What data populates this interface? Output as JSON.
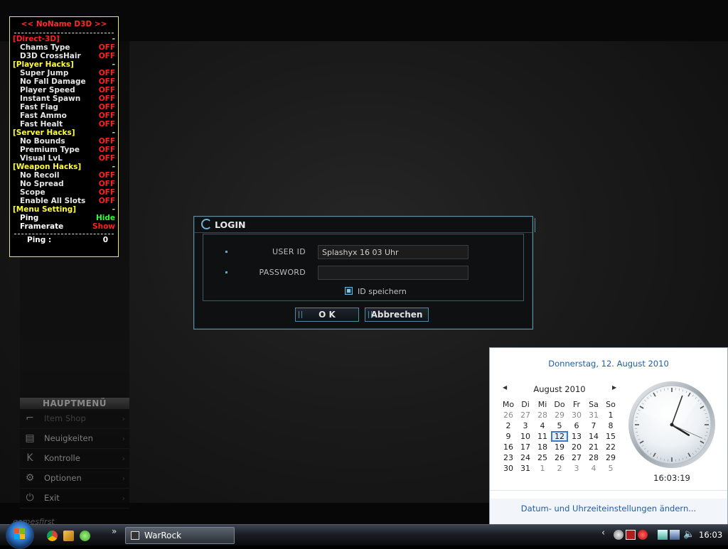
{
  "hack_menu": {
    "title": "<< NoName D3D >>",
    "rows": [
      {
        "label": "[Direct-3D]",
        "kind": "cat red",
        "value": "-",
        "vclass": "dash"
      },
      {
        "label": "Chams Type",
        "kind": "item",
        "value": "OFF",
        "vclass": "off"
      },
      {
        "label": "D3D CrossHair",
        "kind": "item",
        "value": "OFF",
        "vclass": "off"
      },
      {
        "label": "[Player Hacks]",
        "kind": "cat",
        "value": "-",
        "vclass": "dash"
      },
      {
        "label": "Super Jump",
        "kind": "item",
        "value": "OFF",
        "vclass": "off"
      },
      {
        "label": "No Fall Damage",
        "kind": "item",
        "value": "OFF",
        "vclass": "off"
      },
      {
        "label": "Player Speed",
        "kind": "item",
        "value": "OFF",
        "vclass": "off"
      },
      {
        "label": "Instant Spawn",
        "kind": "item",
        "value": "OFF",
        "vclass": "off"
      },
      {
        "label": "Fast Flag",
        "kind": "item",
        "value": "OFF",
        "vclass": "off"
      },
      {
        "label": "Fast Ammo",
        "kind": "item",
        "value": "OFF",
        "vclass": "off"
      },
      {
        "label": "Fast Healt",
        "kind": "item",
        "value": "OFF",
        "vclass": "off"
      },
      {
        "label": "[Server  Hacks]",
        "kind": "cat",
        "value": "-",
        "vclass": "dash"
      },
      {
        "label": "No Bounds",
        "kind": "item",
        "value": "OFF",
        "vclass": "off"
      },
      {
        "label": "Premium Type",
        "kind": "item",
        "value": "OFF",
        "vclass": "off"
      },
      {
        "label": "Visual LvL",
        "kind": "item",
        "value": "OFF",
        "vclass": "off"
      },
      {
        "label": "[Weapon  Hacks]",
        "kind": "cat",
        "value": "-",
        "vclass": "dash"
      },
      {
        "label": "No Recoil",
        "kind": "item",
        "value": "OFF",
        "vclass": "off"
      },
      {
        "label": "No Spread",
        "kind": "item",
        "value": "OFF",
        "vclass": "off"
      },
      {
        "label": "Scope",
        "kind": "item",
        "value": "OFF",
        "vclass": "off"
      },
      {
        "label": "Enable All Slots",
        "kind": "item",
        "value": "OFF",
        "vclass": "off"
      },
      {
        "label": "[Menu Setting]",
        "kind": "cat",
        "value": "-",
        "vclass": "dash"
      },
      {
        "label": "Ping",
        "kind": "item white",
        "value": "Hide",
        "vclass": "hide"
      },
      {
        "label": "Framerate",
        "kind": "item white",
        "value": "Show",
        "vclass": "show"
      }
    ],
    "ping_label": "Ping :",
    "ping_value": "0"
  },
  "main_menu": {
    "header": "HAUPTMENÜ",
    "items": [
      {
        "label": "Item Shop",
        "icon": "gun-icon",
        "glyph": "⌐",
        "dim": true
      },
      {
        "label": "Neuigkeiten",
        "icon": "news-icon",
        "glyph": "▤",
        "dim": false
      },
      {
        "label": "Kontrolle",
        "icon": "keyboard-k-icon",
        "glyph": "K",
        "dim": false
      },
      {
        "label": "Optionen",
        "icon": "gear-icon",
        "glyph": "⚙",
        "dim": false
      },
      {
        "label": "Exit",
        "icon": "power-icon",
        "glyph": "⏻",
        "dim": false
      }
    ],
    "chevron": "›"
  },
  "brand_text": "gamesfirst",
  "login": {
    "title": "LOGIN",
    "user_label": "USER ID",
    "user_value": "Splashyx 16 03 Uhr",
    "password_label": "PASSWORD",
    "password_value": "",
    "remember_label": "ID speichern",
    "ok_label": "O K",
    "cancel_label": "Abbrechen"
  },
  "calendar": {
    "long_date": "Donnerstag, 12. August 2010",
    "month_label": "August 2010",
    "prev": "◀",
    "next": "▶",
    "weekdays": [
      "Mo",
      "Di",
      "Mi",
      "Do",
      "Fr",
      "Sa",
      "So"
    ],
    "weeks": [
      [
        "26",
        "27",
        "28",
        "29",
        "30",
        "31",
        "1"
      ],
      [
        "2",
        "3",
        "4",
        "5",
        "6",
        "7",
        "8"
      ],
      [
        "9",
        "10",
        "11",
        "12",
        "13",
        "14",
        "15"
      ],
      [
        "16",
        "17",
        "18",
        "19",
        "20",
        "21",
        "22"
      ],
      [
        "23",
        "24",
        "25",
        "26",
        "27",
        "28",
        "29"
      ],
      [
        "30",
        "31",
        "1",
        "2",
        "3",
        "4",
        "5"
      ]
    ],
    "today": "12",
    "time_text": "16:03:19",
    "clock": {
      "hours": 16,
      "minutes": 3,
      "seconds": 19
    },
    "settings_link": "Datum- und Uhrzeiteinstellungen ändern..."
  },
  "taskbar": {
    "more": "»",
    "window_label": "WarRock",
    "tray_arrow": "‹",
    "clock": "16:03"
  }
}
